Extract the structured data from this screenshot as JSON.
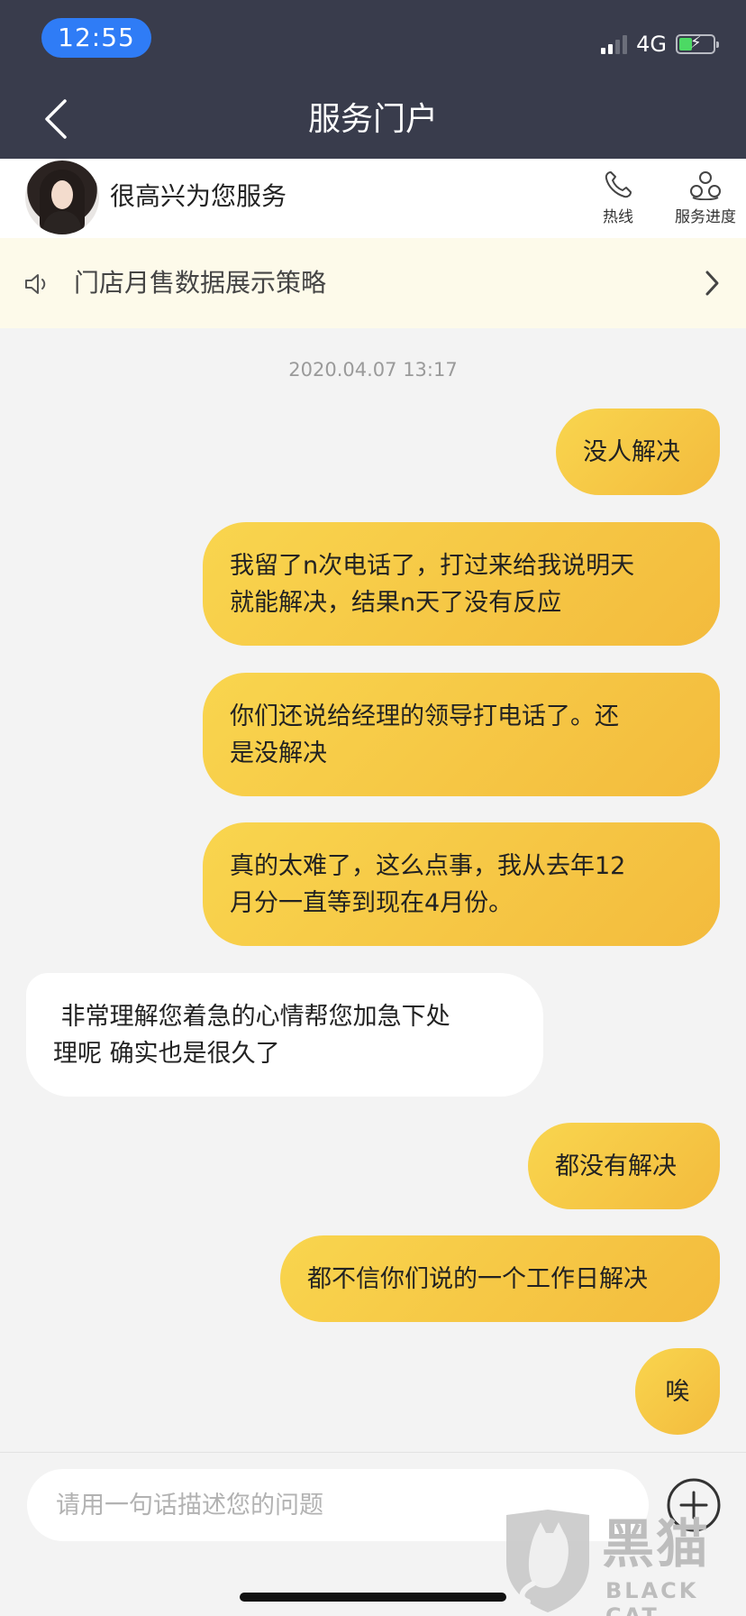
{
  "status_bar": {
    "time": "12:55",
    "network": "4G"
  },
  "nav": {
    "title": "服务门户"
  },
  "agent": {
    "name": "很高兴为您服务",
    "hotline_label": "热线",
    "progress_label": "服务进度"
  },
  "notice": {
    "text": "门店月售数据展示策略"
  },
  "chat": {
    "timestamp": "2020.04.07 13:17",
    "messages": [
      {
        "from": "me",
        "line1": "没人解决",
        "line2": ""
      },
      {
        "from": "me",
        "line1": "我留了n次电话了，打过来给我说明天",
        "line2": "就能解决，结果n天了没有反应"
      },
      {
        "from": "me",
        "line1": "你们还说给经理的领导打电话了。还",
        "line2": "是没解决"
      },
      {
        "from": "me",
        "line1": "真的太难了，这么点事，我从去年12",
        "line2": "月分一直等到现在4月份。"
      },
      {
        "from": "agent",
        "line1": " 非常理解您着急的心情帮您加急下处",
        "line2": "理呢 确实也是很久了"
      },
      {
        "from": "me",
        "line1": "都没有解决",
        "line2": ""
      },
      {
        "from": "me",
        "line1": "都不信你们说的一个工作日解决",
        "line2": ""
      },
      {
        "from": "me",
        "line1": "唉",
        "line2": ""
      }
    ]
  },
  "input": {
    "placeholder": "请用一句话描述您的问题",
    "value": ""
  },
  "watermark": {
    "text": "黑猫",
    "sub": "BLACK CAT"
  },
  "colors": {
    "nav_bg": "#393c4c",
    "time_pill": "#2f7cf6",
    "bubble_me": "#f6c945",
    "bubble_agent": "#ffffff",
    "notice_bg": "#fdfaea"
  }
}
